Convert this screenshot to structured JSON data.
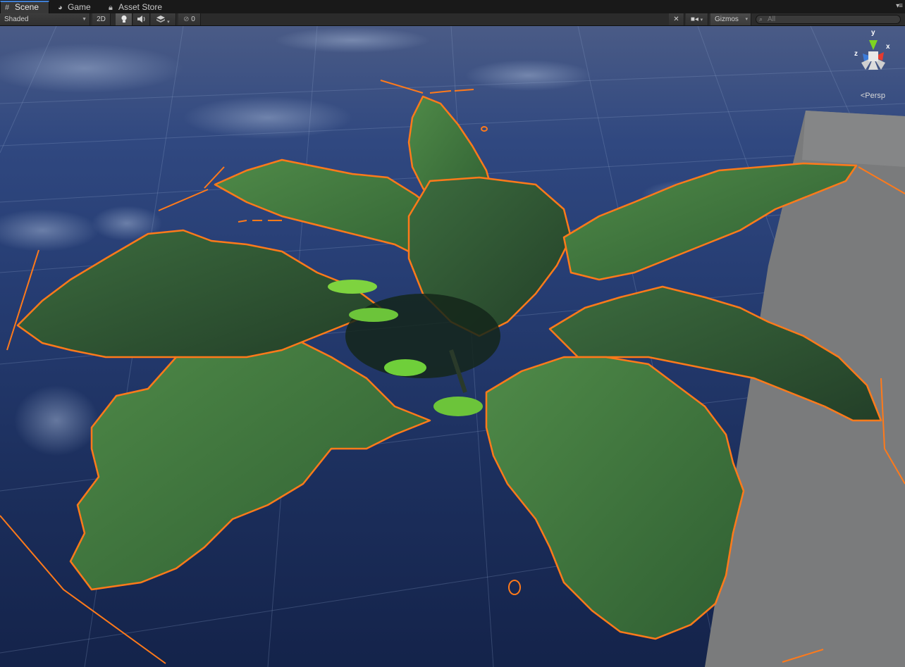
{
  "tabs": [
    {
      "label": "Scene",
      "icon": "grid-icon",
      "active": true
    },
    {
      "label": "Game",
      "icon": "pacman-icon",
      "active": false
    },
    {
      "label": "Asset Store",
      "icon": "lock-icon",
      "active": false
    }
  ],
  "toolbar": {
    "draw_mode": "Shaded",
    "mode_2d": "2D",
    "lighting_icon": "lightbulb-icon",
    "audio_icon": "speaker-icon",
    "effects_icon": "image-effects-icon",
    "hidden_count": "0",
    "tools_icon": "tools-icon",
    "camera_icon": "camera-icon",
    "gizmos_label": "Gizmos",
    "search_placeholder": "All"
  },
  "gizmo": {
    "x_label": "x",
    "y_label": "y",
    "z_label": "z",
    "projection": "Persp"
  },
  "colors": {
    "selection_outline": "#ff7a1a",
    "leaf_green": "#3f7a3c",
    "axis_x": "#e53a2e",
    "axis_y": "#7ed321",
    "axis_z": "#3b7bd9"
  }
}
